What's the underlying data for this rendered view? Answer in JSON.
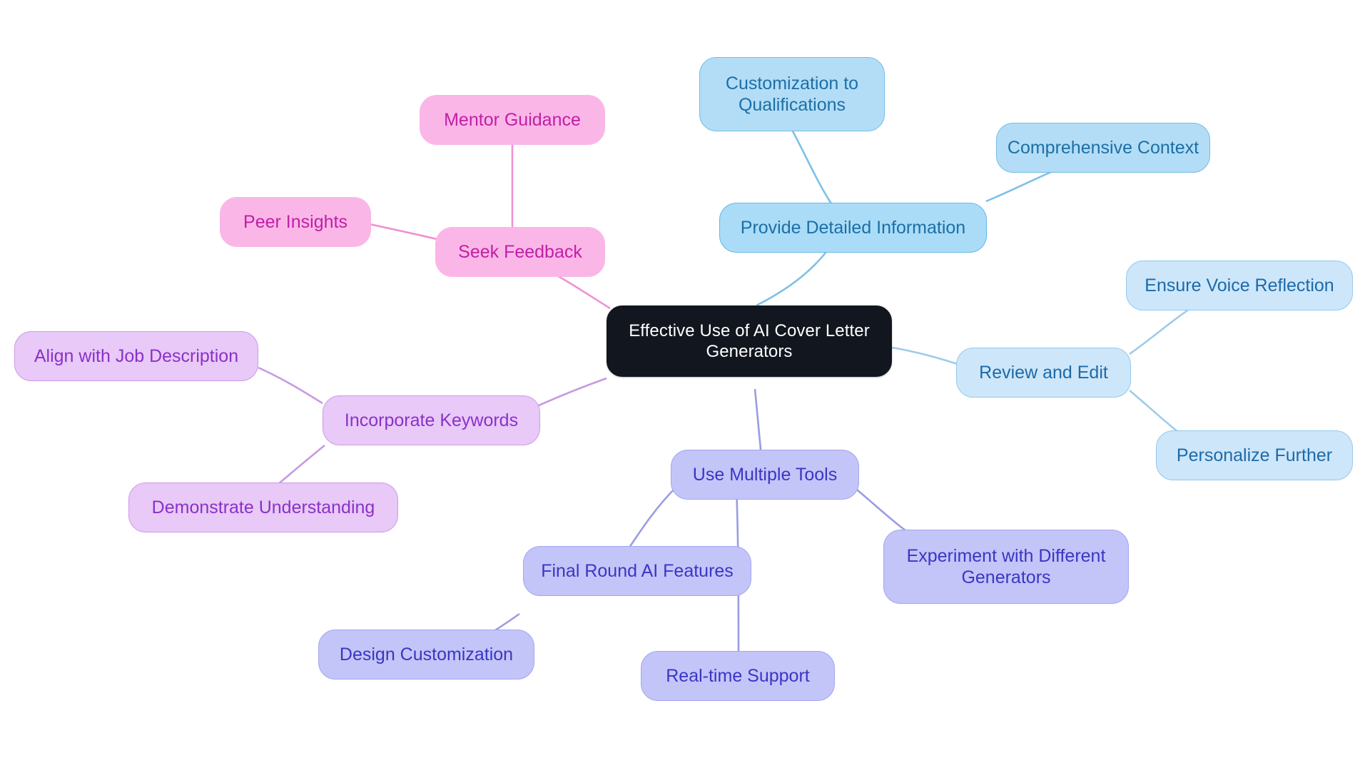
{
  "diagram": {
    "type": "mindmap",
    "title": "Effective Use of AI Cover Letter Generators",
    "background_color": "#ffffff",
    "root": {
      "id": "root",
      "label": "Effective Use of AI Cover Letter\nGenerators",
      "fill": "#12161f",
      "text_color": "#ffffff"
    },
    "branches": [
      {
        "id": "provide-detailed-information",
        "label": "Provide Detailed Information",
        "fill": "#aadcf8",
        "border": "#63b8e8",
        "text_color": "#1d6fa5",
        "children": [
          {
            "id": "customization-to-qualifications",
            "label": "Customization to\nQualifications",
            "fill": "#b3ddf7",
            "border": "#74bce6",
            "text_color": "#1d6fa5"
          },
          {
            "id": "comprehensive-context",
            "label": "Comprehensive Context",
            "fill": "#b3ddf7",
            "border": "#74bce6",
            "text_color": "#1d6fa5"
          }
        ]
      },
      {
        "id": "review-and-edit",
        "label": "Review and Edit",
        "fill": "#cde6fa",
        "border": "#96c8ec",
        "text_color": "#1d6aa8",
        "children": [
          {
            "id": "ensure-voice-reflection",
            "label": "Ensure Voice Reflection",
            "fill": "#cde6fa",
            "border": "#96c8ec",
            "text_color": "#1d6aa8"
          },
          {
            "id": "personalize-further",
            "label": "Personalize Further",
            "fill": "#cde6fa",
            "border": "#96c8ec",
            "text_color": "#1d6aa8"
          }
        ]
      },
      {
        "id": "use-multiple-tools",
        "label": "Use Multiple Tools",
        "fill": "#c3c5f8",
        "border": "#a3a6ee",
        "text_color": "#3b35c4",
        "children": [
          {
            "id": "experiment-with-different-generators",
            "label": "Experiment with Different\nGenerators",
            "fill": "#c3c5f8",
            "border": "#a3a6ee",
            "text_color": "#3b35c4"
          },
          {
            "id": "final-round-ai-features",
            "label": "Final Round AI Features",
            "fill": "#c3c5f8",
            "border": "#a3a6ee",
            "text_color": "#3b35c4"
          },
          {
            "id": "design-customization",
            "label": "Design Customization",
            "fill": "#c3c5f8",
            "border": "#a3a6ee",
            "text_color": "#3b35c4"
          },
          {
            "id": "real-time-support",
            "label": "Real-time Support",
            "fill": "#c3c5f8",
            "border": "#a3a6ee",
            "text_color": "#3b35c4"
          }
        ]
      },
      {
        "id": "incorporate-keywords",
        "label": "Incorporate Keywords",
        "fill": "#e8c9f7",
        "border": "#cc9ae8",
        "text_color": "#8a31c9",
        "children": [
          {
            "id": "align-with-job-description",
            "label": "Align with Job Description",
            "fill": "#e8c9f7",
            "border": "#cc9ae8",
            "text_color": "#8a31c9"
          },
          {
            "id": "demonstrate-understanding",
            "label": "Demonstrate Understanding",
            "fill": "#e8c9f7",
            "border": "#cc9ae8",
            "text_color": "#8a31c9"
          }
        ]
      },
      {
        "id": "seek-feedback",
        "label": "Seek Feedback",
        "fill": "#fbb6e8",
        "border": "#fbb6e8",
        "text_color": "#c01fa5",
        "children": [
          {
            "id": "mentor-guidance",
            "label": "Mentor Guidance",
            "fill": "#fbb6e8",
            "border": "#fbb6e8",
            "text_color": "#c01fa5"
          },
          {
            "id": "peer-insights",
            "label": "Peer Insights",
            "fill": "#fbb6e8",
            "border": "#fbb6e8",
            "text_color": "#c01fa5"
          }
        ]
      }
    ],
    "edge_colors": {
      "blue": "#7fc0e8",
      "pale_blue": "#9fcbe8",
      "pink": "#ef92d4",
      "violet": "#c79ae0",
      "periwinkle": "#9a9de2"
    }
  }
}
